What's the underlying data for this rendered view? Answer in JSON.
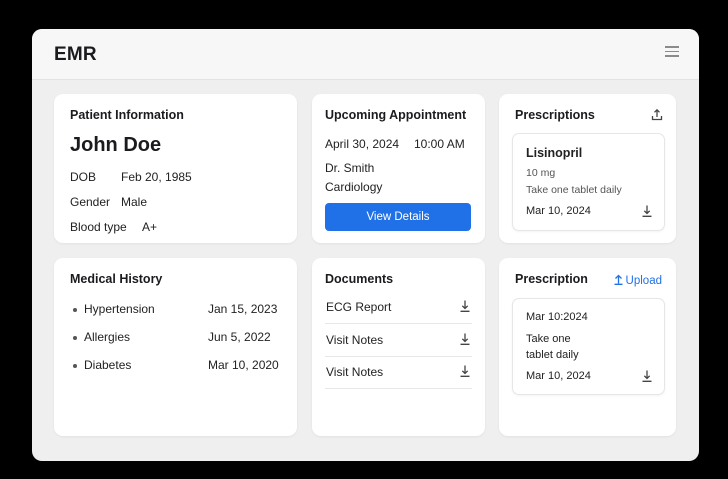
{
  "app": {
    "title": "EMR",
    "menu_icon": "hamburger-menu-icon"
  },
  "patient": {
    "heading": "Patient Information",
    "name": "John Doe",
    "dob_label": "DOB",
    "dob": "Feb 20, 1985",
    "gender_label": "Gender",
    "gender": "Male",
    "blood_label": "Blood type",
    "blood": "A+"
  },
  "appointment": {
    "heading": "Upcoming Appointment",
    "date": "April 30, 2024",
    "time": "10:00 AM",
    "doctor": "Dr. Smith",
    "department": "Cardiology",
    "button": "View Details",
    "button_color": "#2071e8"
  },
  "prescriptions": {
    "heading": "Prescriptions",
    "share_icon": "share-icon",
    "item": {
      "drug": "Lisinopril",
      "dose": "10 mg",
      "instructions": "Take one tablet daily",
      "date": "Mar 10, 2024",
      "download_icon": "download-icon"
    }
  },
  "history": {
    "heading": "Medical History",
    "items": [
      {
        "condition": "Hypertension",
        "date": "Jan 15, 2023"
      },
      {
        "condition": "Allergies",
        "date": "Jun 5, 2022"
      },
      {
        "condition": "Diabetes",
        "date": "Mar 10, 2020"
      }
    ]
  },
  "documents": {
    "heading": "Documents",
    "items": [
      {
        "name": "ECG Report",
        "icon": "download-icon"
      },
      {
        "name": "Visit Notes",
        "icon": "download-icon"
      },
      {
        "name": "Visit Notes",
        "icon": "download-icon"
      }
    ]
  },
  "prescription_upload": {
    "heading": "Prescription",
    "upload_label": "Upload",
    "upload_icon": "upload-arrow-icon",
    "accent": "#2071e8",
    "item": {
      "header": "Mar 10:2024",
      "instructions_line1": "Take one",
      "instructions_line2": "tablet daily",
      "date": "Mar 10, 2024",
      "download_icon": "download-icon"
    }
  }
}
